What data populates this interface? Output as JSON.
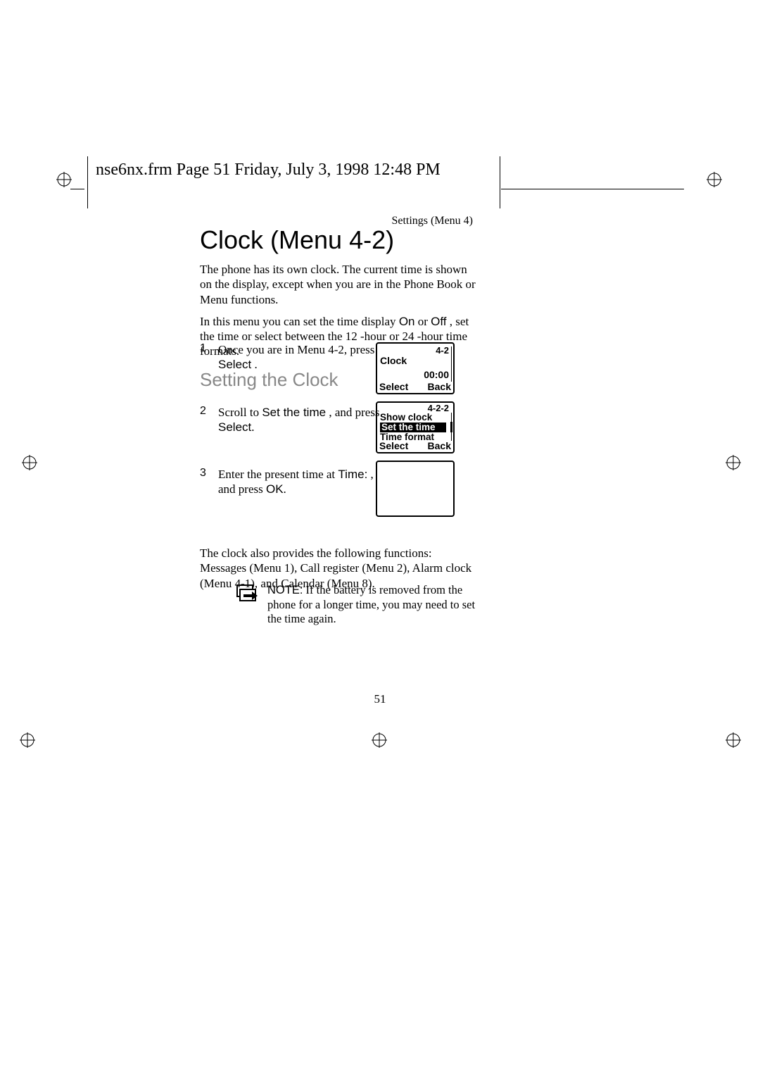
{
  "header": {
    "frame_line": "nse6nx.frm  Page 51  Friday, July 3, 1998  12:48 PM"
  },
  "breadcrumb": "Settings (Menu 4)",
  "title": "Clock (Menu 4-2)",
  "intro_p1": "The phone has its own clock. The current time is shown on the display, except when you are in the Phone Book or Menu functions.",
  "intro_p2_a": "In this menu you can set the time display ",
  "intro_p2_on": "On",
  "intro_p2_b": " or ",
  "intro_p2_off": "Off",
  "intro_p2_c": " , set the time or select between the 12 -hour or 24 -hour time formats.",
  "subsection": "Setting the Clock",
  "steps": [
    {
      "num": "1",
      "pre": "Once you are in Menu 4-2, press ",
      "cmd": "Select",
      "post": " ."
    },
    {
      "num": "2",
      "pre": "Scroll to ",
      "cmd": "Set the time",
      "mid": " , and press ",
      "cmd2": "Select",
      "post": "."
    },
    {
      "num": "3",
      "pre": "Enter the present time at ",
      "cmd": "Time:",
      "mid": " , and press ",
      "cmd2": "OK",
      "post": "."
    }
  ],
  "screen1": {
    "menu_no": "4-2",
    "title": "Clock",
    "time": "00:00",
    "soft_left": "Select",
    "soft_right": "Back"
  },
  "screen2": {
    "menu_no": "4-2-2",
    "line1": "Show clock",
    "line2": "Set the time",
    "line3": "Time format",
    "soft_left": "Select",
    "soft_right": "Back"
  },
  "after_steps": "The clock also provides the following functions: Messages (Menu 1), Call register (Menu 2), Alarm clock (Menu 4-1), and Calendar (Menu 8).",
  "note": {
    "label": "NOTE:",
    "text": "If the battery is removed from the phone for a longer time, you may need to set the time again."
  },
  "page_number": "51"
}
